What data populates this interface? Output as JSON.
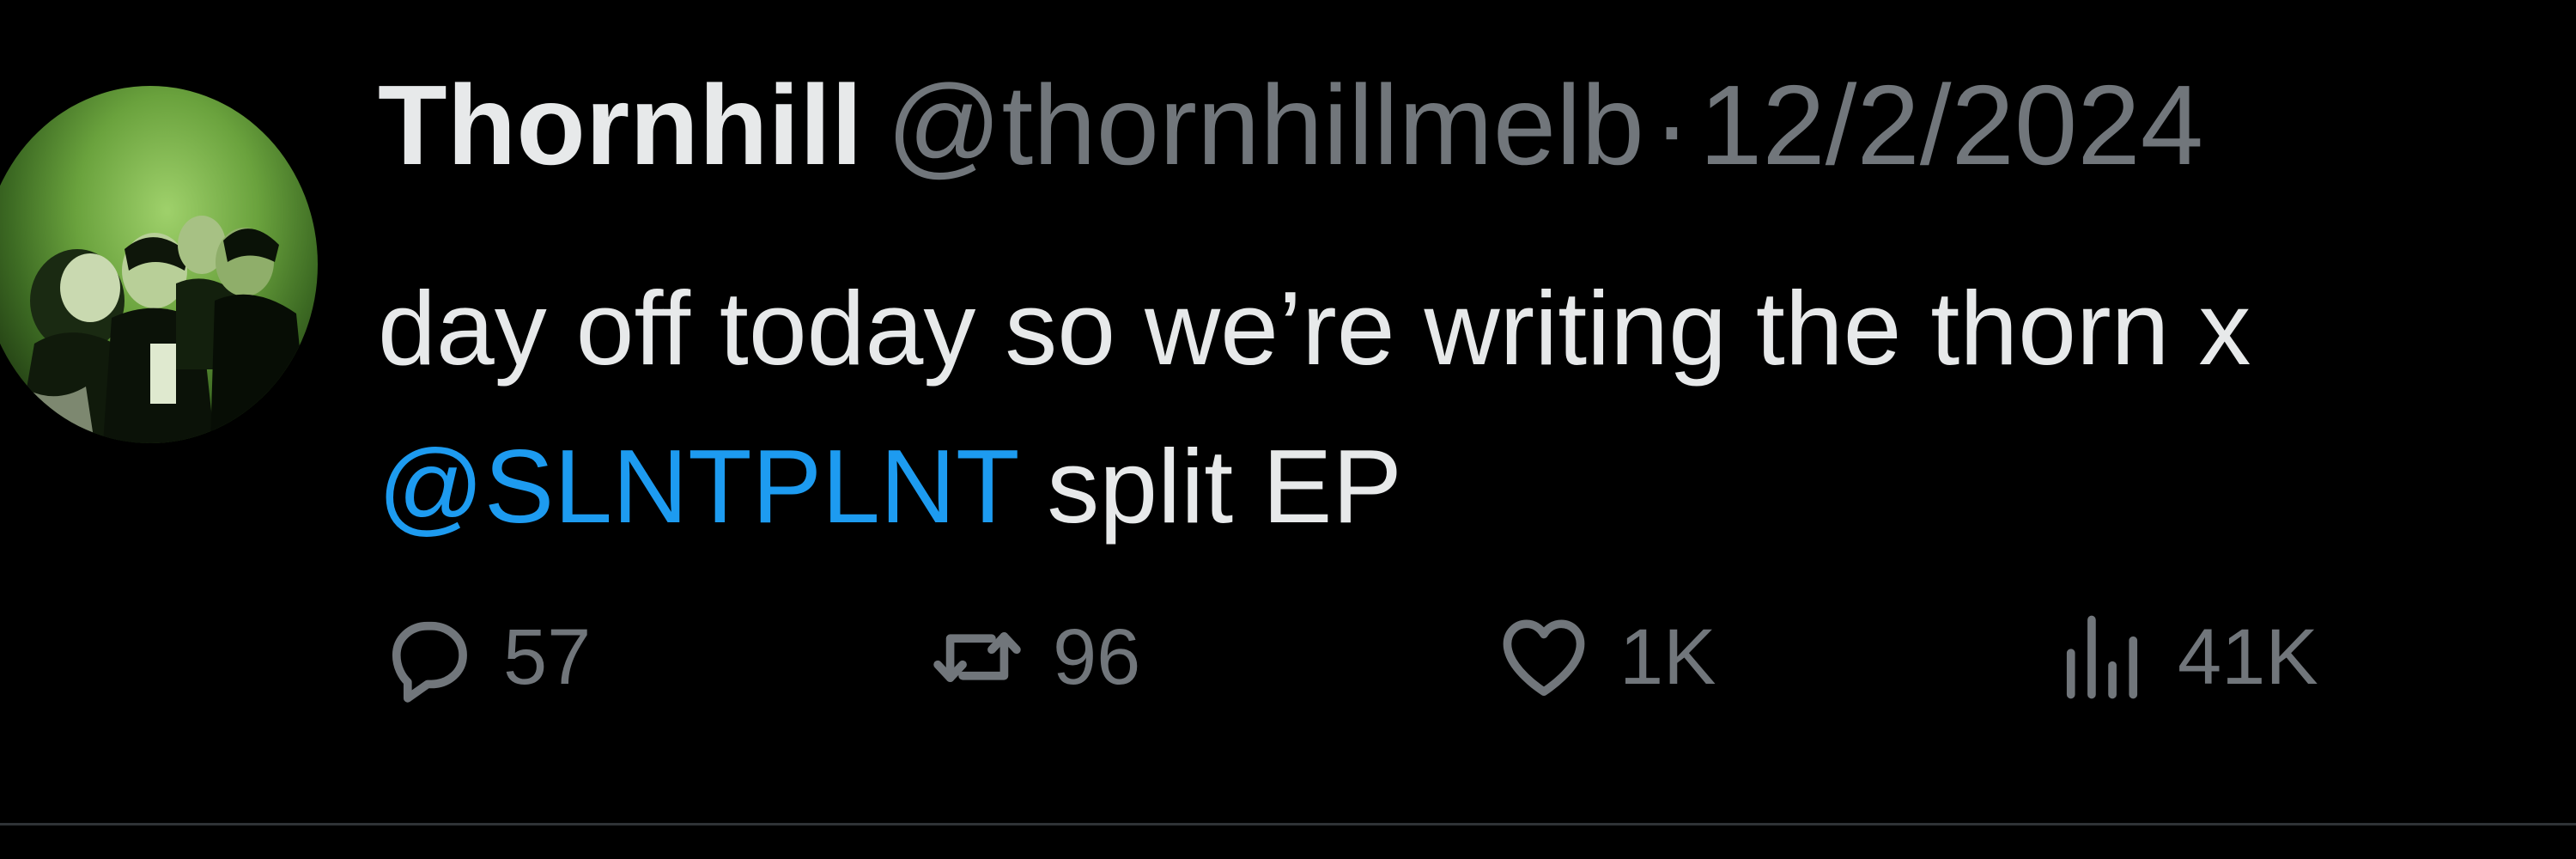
{
  "tweet": {
    "display_name": "Thornhill",
    "handle": "@thornhillmelb",
    "separator": "·",
    "date": "12/2/2024",
    "text_line1": "day off today so we’re writing the thorn x",
    "mention": "@SLNTPLNT",
    "text_line2_rest": " split EP"
  },
  "actions": {
    "replies": "57",
    "retweets": "96",
    "likes": "1K",
    "views": "41K"
  },
  "icons": {
    "reply": "reply-icon",
    "retweet": "retweet-icon",
    "like": "heart-icon",
    "views": "views-icon"
  },
  "colors": {
    "background": "#000000",
    "primary_text": "#e7e9ea",
    "secondary_text": "#71767b",
    "mention": "#1d9bf0",
    "divider": "#2f3336"
  }
}
